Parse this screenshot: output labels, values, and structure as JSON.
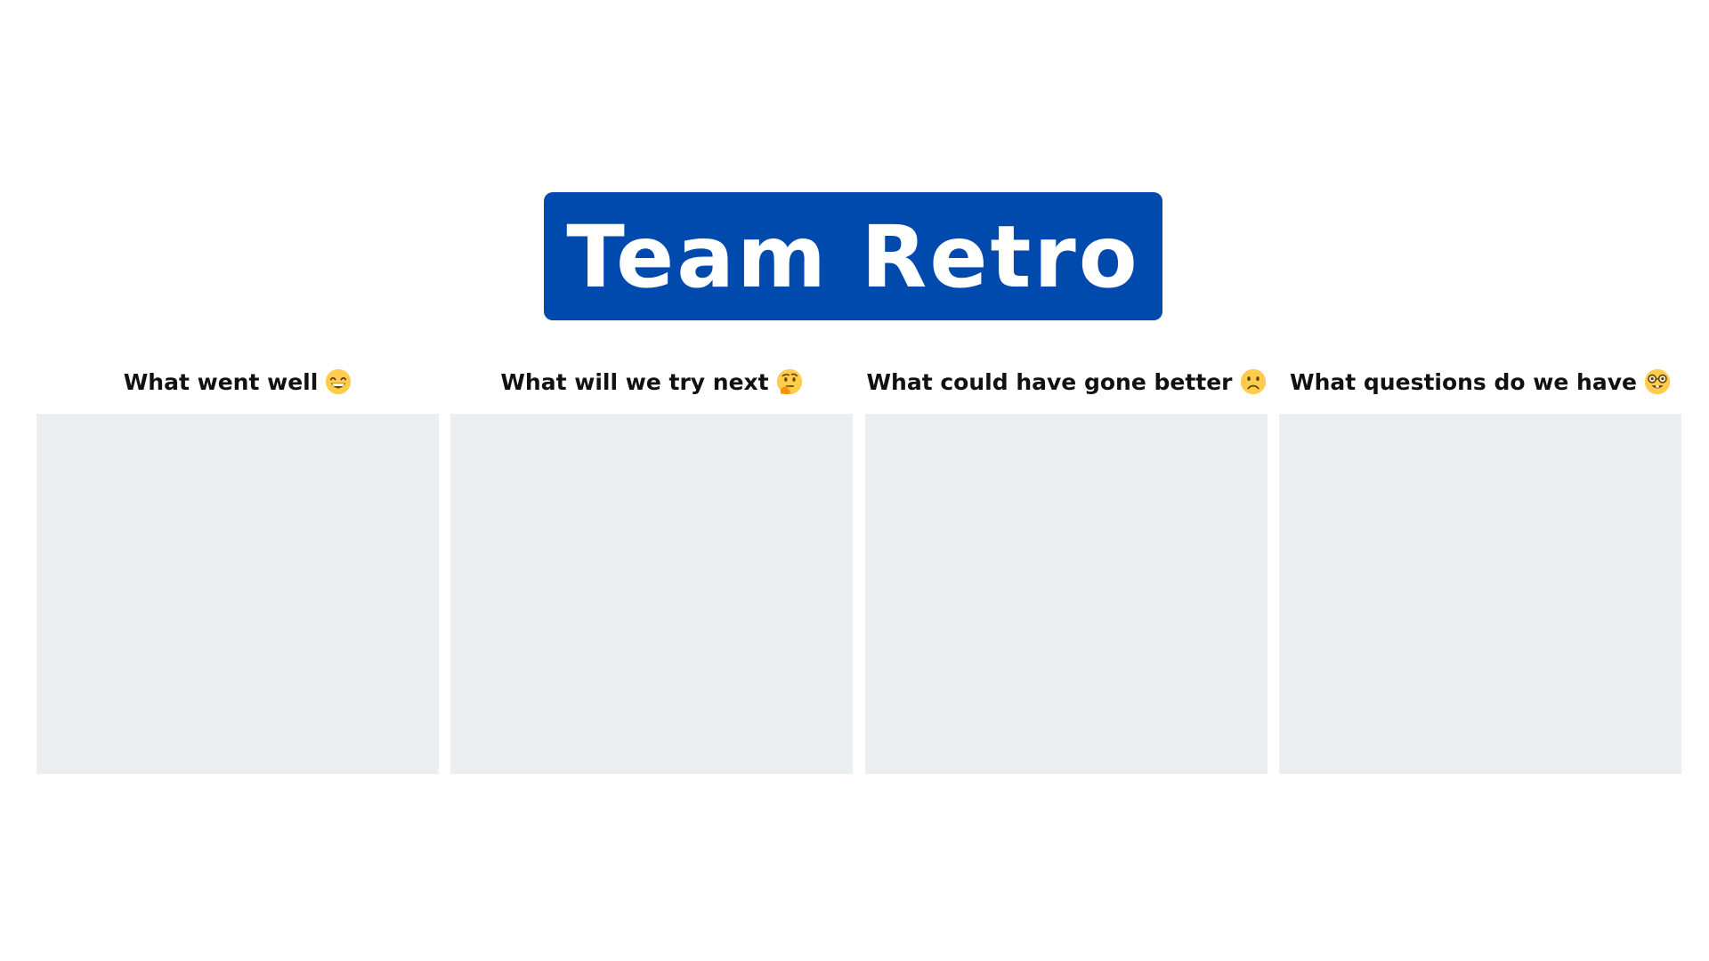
{
  "title": "Team Retro",
  "colors": {
    "banner": "#004aad",
    "board": "#ebeff2",
    "emoji_face": "#ffcc4d"
  },
  "columns": [
    {
      "label": "What went well",
      "icon": "grinning-face-icon"
    },
    {
      "label": "What will we try next",
      "icon": "thinking-face-icon"
    },
    {
      "label": "What could have gone better",
      "icon": "slightly-frowning-face-icon"
    },
    {
      "label": "What questions do we have",
      "icon": "nerd-face-icon"
    }
  ]
}
